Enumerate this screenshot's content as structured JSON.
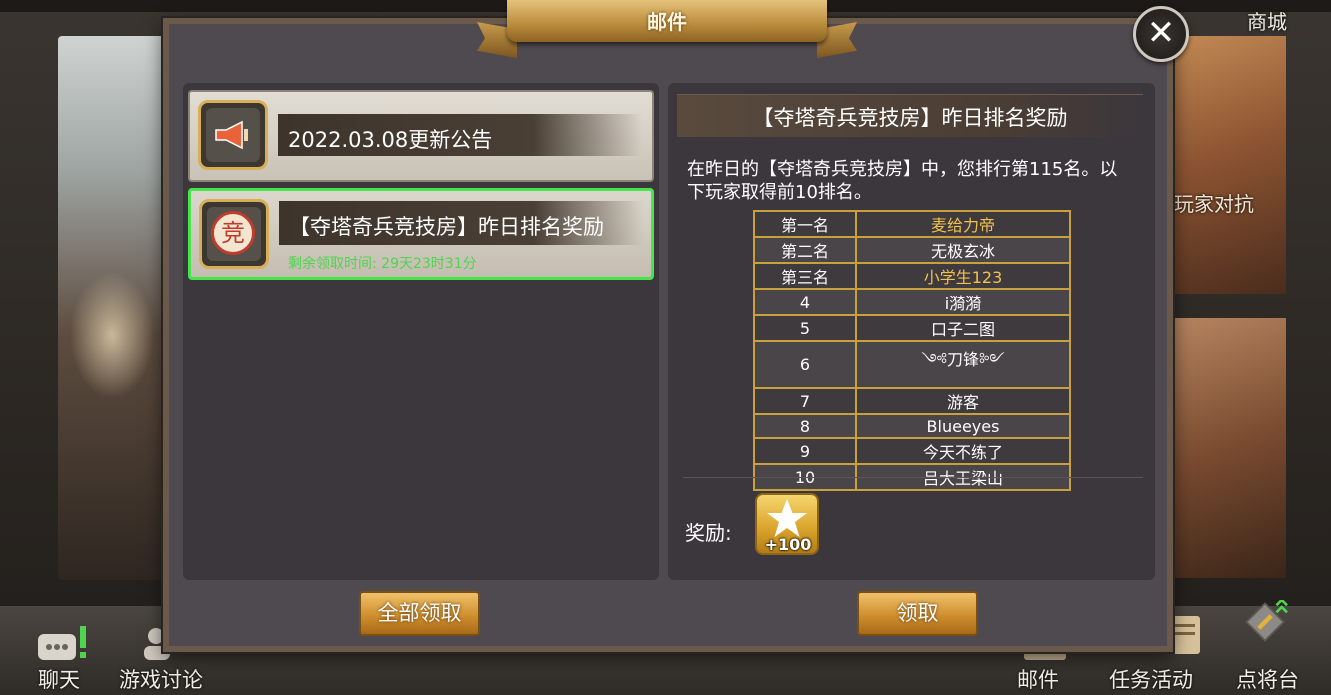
{
  "window": {
    "title": "邮件"
  },
  "background": {
    "right_text": "玩家对抗",
    "shop_label": "商城"
  },
  "bottom_nav": {
    "chat": "聊天",
    "discussion": "游戏讨论",
    "mail": "邮件",
    "tasks": "任务活动",
    "general_platform": "点将台"
  },
  "mail_list": [
    {
      "title": "2022.03.08更新公告",
      "icon": "speaker-icon"
    },
    {
      "title": "【夺塔奇兵竞技房】昨日排名奖励",
      "icon": "seal-icon",
      "seal_char": "竞",
      "remaining": "剩余领取时间: 29天23时31分",
      "selected": true
    }
  ],
  "detail": {
    "title": "【夺塔奇兵竞技房】昨日排名奖励",
    "body": "在昨日的【夺塔奇兵竞技房】中，您排行第115名。以下玩家取得前10排名。",
    "rankings": [
      {
        "rank": "第一名",
        "name": "麦给力帝"
      },
      {
        "rank": "第二名",
        "name": "无极玄冰"
      },
      {
        "rank": "第三名",
        "name": "小学生123"
      },
      {
        "rank": "4",
        "name": "i漪漪"
      },
      {
        "rank": "5",
        "name": "口子二图"
      },
      {
        "rank": "6",
        "name": "༺刀锋༻"
      },
      {
        "rank": "7",
        "name": "游客"
      },
      {
        "rank": "8",
        "name": "Blueeyes"
      },
      {
        "rank": "9",
        "name": "今天不练了"
      },
      {
        "rank": "10",
        "name": "吕大王梁山"
      }
    ],
    "reward_label": "奖励:",
    "reward_amount": "+100"
  },
  "buttons": {
    "claim_all": "全部领取",
    "claim": "领取"
  },
  "colors": {
    "selected_border": "#46e64a",
    "table_border": "#c9a13c",
    "gold_text": "#f2c14e",
    "button_gold": "#cf8f2f"
  }
}
